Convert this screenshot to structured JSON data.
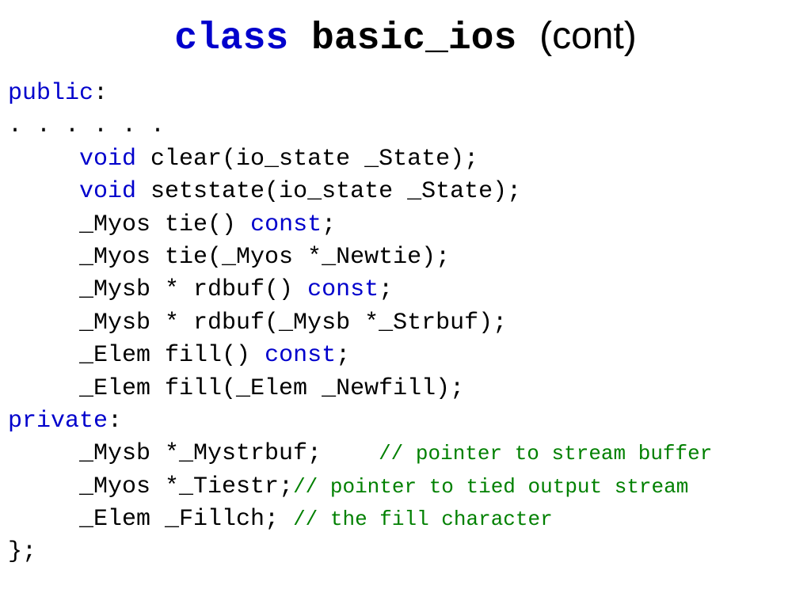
{
  "title": {
    "keyword": "class",
    "name": "basic_ios",
    "cont": "(cont)"
  },
  "code": {
    "l1_kw": "public",
    "l1_rest": ":",
    "l2": ". . . . . .",
    "l3_kw": "void",
    "l3_rest": " clear(io_state _State);",
    "l4_kw": "void",
    "l4_rest": " setstate(io_state _State);",
    "l5_pre": "     _Myos tie() ",
    "l5_kw": "const",
    "l5_rest": ";",
    "l6": "     _Myos tie(_Myos *_Newtie);",
    "l7_pre": "     _Mysb * rdbuf() ",
    "l7_kw": "const",
    "l7_rest": ";",
    "l8": "     _Mysb * rdbuf(_Mysb *_Strbuf);",
    "l9_pre": "     _Elem fill() ",
    "l9_kw": "const",
    "l9_rest": ";",
    "l10": "     _Elem fill(_Elem _Newfill);",
    "l11_kw": "private",
    "l11_rest": ":",
    "l12_pre": "     _Mysb *_Mystrbuf;    ",
    "l12_cm": "// pointer to stream buffer",
    "l13_pre": "     _Myos *_Tiestr;",
    "l13_cm": "// pointer to tied output stream",
    "l14_pre": "     _Elem _Fillch; ",
    "l14_cm": "// the fill character",
    "l15": "};"
  }
}
